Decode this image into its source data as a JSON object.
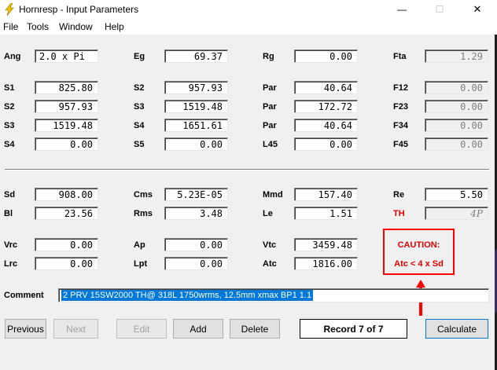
{
  "window": {
    "title": "Hornresp - Input Parameters",
    "min_glyph": "—",
    "max_glyph": "☐",
    "close_glyph": "✕"
  },
  "menu": [
    "File",
    "Tools",
    "Window",
    "Help"
  ],
  "labels": {
    "ang": "Ang",
    "eg": "Eg",
    "rg": "Rg",
    "fta": "Fta",
    "s1": "S1",
    "s2a": "S2",
    "par1": "Par",
    "f12": "F12",
    "s2b": "S2",
    "s3a": "S3",
    "par2": "Par",
    "f23": "F23",
    "s3b": "S3",
    "s4a": "S4",
    "par3": "Par",
    "f34": "F34",
    "s4b": "S4",
    "s5": "S5",
    "l45": "L45",
    "f45": "F45",
    "sd": "Sd",
    "cms": "Cms",
    "mmd": "Mmd",
    "re": "Re",
    "bl": "Bl",
    "rms": "Rms",
    "le": "Le",
    "th": "TH",
    "vrc": "Vrc",
    "ap": "Ap",
    "vtc": "Vtc",
    "lrc": "Lrc",
    "lpt": "Lpt",
    "atc": "Atc",
    "comment": "Comment"
  },
  "values": {
    "ang": "2.0 x Pi",
    "eg": "69.37",
    "rg": "0.00",
    "fta": "1.29",
    "s1": "825.80",
    "s2a": "957.93",
    "par1": "40.64",
    "f12": "0.00",
    "s2b": "957.93",
    "s3a": "1519.48",
    "par2": "172.72",
    "f23": "0.00",
    "s3b": "1519.48",
    "s4a": "1651.61",
    "par3": "40.64",
    "f34": "0.00",
    "s4b": "0.00",
    "s5": "0.00",
    "l45": "0.00",
    "f45": "0.00",
    "sd": "908.00",
    "cms": "5.23E-05",
    "mmd": "157.40",
    "re": "5.50",
    "bl": "23.56",
    "rms": "3.48",
    "le": "1.51",
    "th": "4P",
    "vrc": "0.00",
    "ap": "0.00",
    "vtc": "3459.48",
    "lrc": "0.00",
    "lpt": "0.00",
    "atc": "1816.00"
  },
  "comment": "2 PRV 15SW2000  TH@ 318L 1750wrms, 12.5mm xmax BP1  1.1",
  "caution": {
    "line1": "CAUTION:",
    "line2": "Atc < 4 x Sd"
  },
  "buttons": {
    "previous": "Previous",
    "next": "Next",
    "edit": "Edit",
    "add": "Add",
    "delete": "Delete",
    "record": "Record 7 of 7",
    "calculate": "Calculate"
  },
  "colors": {
    "caution_red": "#ff0000",
    "selection_blue": "#0078d7"
  }
}
